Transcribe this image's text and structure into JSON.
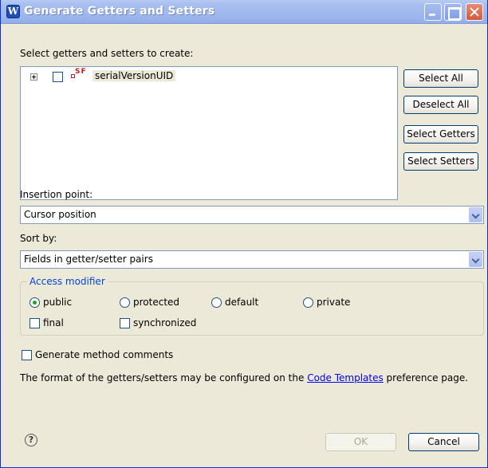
{
  "window": {
    "title": "Generate Getters and Setters",
    "icon": "app-icon",
    "icon_letter": "W"
  },
  "tree": {
    "label": "Select getters and setters to create:",
    "items": [
      {
        "label": "serialVersionUID",
        "icon": "static-final-field-icon",
        "icon_text": "SF",
        "checked": false,
        "expanded": false
      }
    ]
  },
  "side_buttons": {
    "select_all": "Select All",
    "deselect_all": "Deselect All",
    "select_getters": "Select Getters",
    "select_setters": "Select Setters"
  },
  "insertion": {
    "label": "Insertion point:",
    "value": "Cursor position"
  },
  "sort": {
    "label": "Sort by:",
    "value": "Fields in getter/setter pairs"
  },
  "access": {
    "legend": "Access modifier",
    "options": [
      "public",
      "protected",
      "default",
      "private"
    ],
    "selected": "public",
    "final_label": "final",
    "synchronized_label": "synchronized",
    "final_checked": false,
    "synchronized_checked": false
  },
  "comments": {
    "label": "Generate method comments",
    "checked": false
  },
  "info": {
    "prefix": "The format of the getters/setters may be configured on the ",
    "link": "Code Templates",
    "suffix": " preference page."
  },
  "footer": {
    "help": "?",
    "ok": "OK",
    "cancel": "Cancel"
  }
}
